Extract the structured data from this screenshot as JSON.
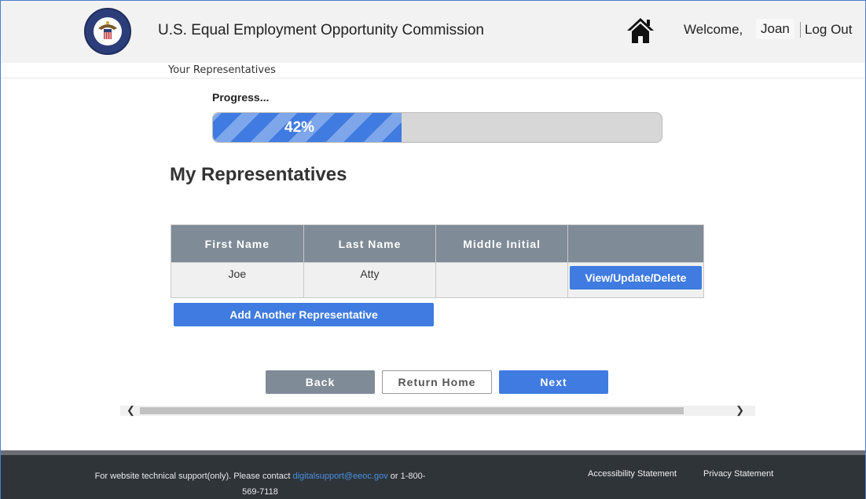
{
  "header": {
    "agency_title": "U.S. Equal Employment Opportunity Commission",
    "welcome_label": "Welcome,",
    "username": "Joan",
    "logout_label": "Log Out"
  },
  "breadcrumb": "Your Representatives",
  "progress": {
    "label": "Progress...",
    "percent": 42,
    "text": "42%",
    "fill_color": "#3f7be0"
  },
  "page_heading": "My Representatives",
  "table": {
    "headers": [
      "First Name",
      "Last Name",
      "Middle Initial",
      ""
    ],
    "rows": [
      {
        "first_name": "Joe",
        "last_name": "Atty",
        "middle_initial": "",
        "action_label": "View/Update/Delete"
      }
    ]
  },
  "add_button_label": "Add Another Representative",
  "nav": {
    "back_label": "Back",
    "return_home_label": "Return Home",
    "next_label": "Next"
  },
  "footer": {
    "support_prefix": "For website technical support(only). Please contact ",
    "support_email": "digitalsupport@eeoc.gov",
    "support_suffix_line1": " or 1-800-",
    "support_suffix_line2": "569-7118",
    "accessibility_label": "Accessibility Statement",
    "privacy_label": "Privacy Statement"
  },
  "colors": {
    "primary_blue": "#3f7be0",
    "header_gray": "#7f8b96",
    "footer_dark": "#2f3439"
  }
}
